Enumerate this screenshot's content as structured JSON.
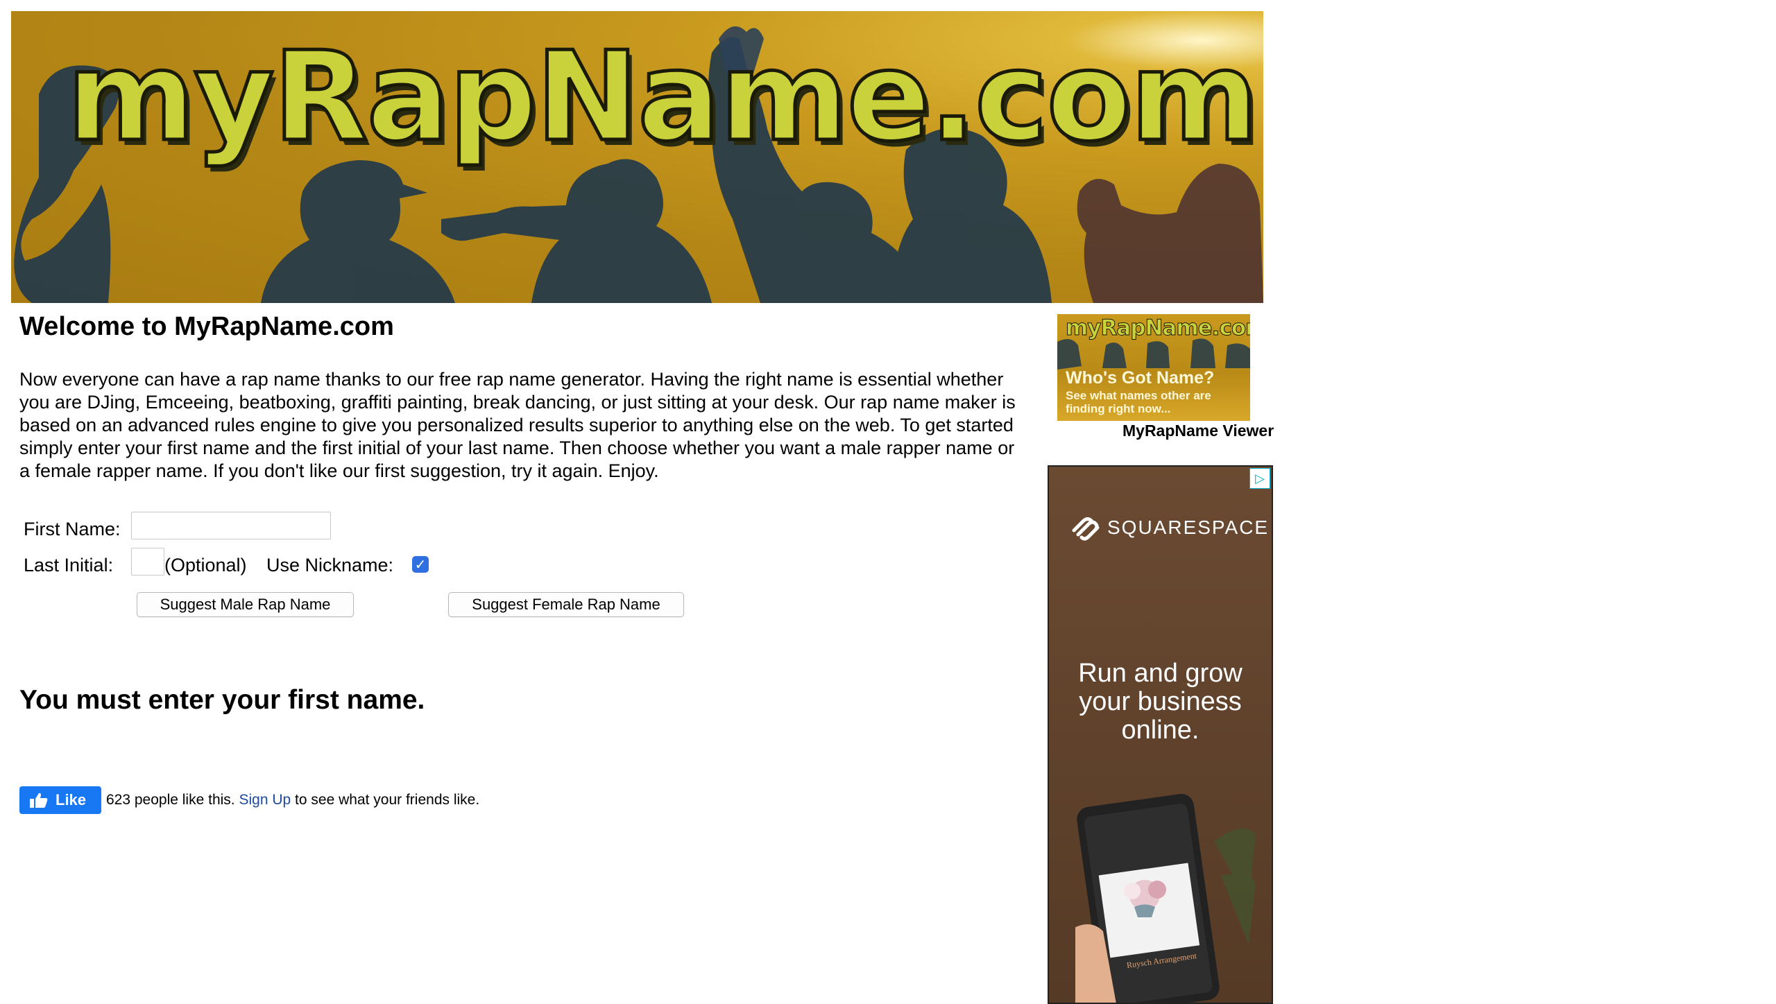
{
  "banner": {
    "title": "myRapName.com"
  },
  "main": {
    "title": "Welcome to MyRapName.com",
    "intro": "Now everyone can have a rap name thanks to our free rap name generator. Having the right name is essential whether you are DJing, Emceeing, beatboxing, graffiti painting, break dancing, or just sitting at your desk. Our rap name maker is based on an advanced rules engine to give you personalized results superior to anything else on the web. To get started simply enter your first name and the first initial of your last name. Then choose whether you want a male rapper name or a female rapper name. If you don't like our first suggestion, try it again. Enjoy."
  },
  "form": {
    "first_name_label": "First Name:",
    "first_name_value": "",
    "last_initial_label": "Last Initial:",
    "last_initial_value": "",
    "optional_label": "(Optional)",
    "nickname_label": "Use Nickname:",
    "nickname_checked": true,
    "male_button": "Suggest Male Rap Name",
    "female_button": "Suggest Female Rap Name"
  },
  "error_message": "You must enter your first name.",
  "facebook": {
    "like_label": "Like",
    "count_text": "623 people like this.",
    "signup_link": "Sign Up",
    "suffix_text": "to see what your friends like."
  },
  "sidebar": {
    "viewer_thumb_title": "myRapName.com",
    "viewer_thumb_heading": "Who's Got Name?",
    "viewer_thumb_sub": "See what names other are finding right now...",
    "viewer_caption": "MyRapName Viewer"
  },
  "ad": {
    "choice_icon": "triangle-play-icon",
    "brand": "SQUARESPACE",
    "headline": "Run and grow your business online.",
    "phone_title": "Ruysch Arrangement",
    "accent_color": "#1877f2"
  }
}
